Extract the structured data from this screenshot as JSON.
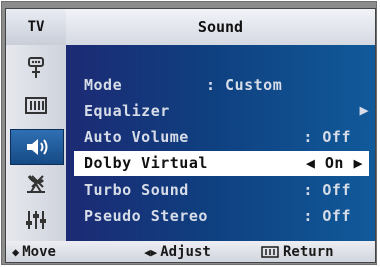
{
  "header": {
    "source_label": "TV",
    "title": "Sound"
  },
  "sidebar": {
    "icons": [
      {
        "name": "input-icon"
      },
      {
        "name": "picture-icon"
      },
      {
        "name": "sound-icon",
        "active": true
      },
      {
        "name": "channel-icon"
      },
      {
        "name": "setup-icon"
      }
    ]
  },
  "menu": {
    "mode": {
      "label": "Mode",
      "value": ": Custom"
    },
    "equalizer": {
      "label": "Equalizer",
      "arrow": "▶"
    },
    "auto_volume": {
      "label": "Auto Volume",
      "value": ": Off"
    },
    "dolby_virtual": {
      "label": "Dolby Virtual",
      "left_arrow": "◀",
      "value": "On",
      "right_arrow": "▶"
    },
    "turbo_sound": {
      "label": "Turbo Sound",
      "value": ": Off"
    },
    "pseudo_stereo": {
      "label": "Pseudo Stereo",
      "value": ": Off"
    }
  },
  "help": {
    "move": {
      "glyph": "◆",
      "label": "Move"
    },
    "adjust": {
      "glyph": "◀▶",
      "label": "Adjust"
    },
    "return": {
      "label": "Return"
    }
  },
  "colors": {
    "accent": "#154a86",
    "selected_row": "#ffffff",
    "menu_bg": "#0f3f7f"
  }
}
